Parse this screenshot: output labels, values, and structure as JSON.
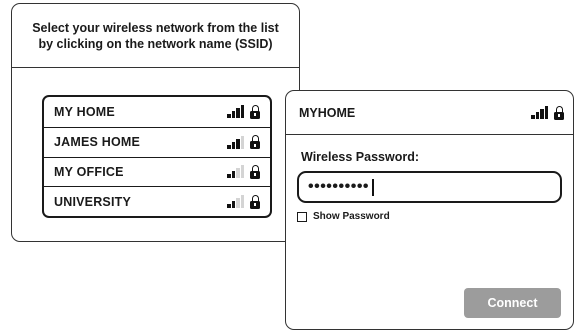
{
  "network_panel": {
    "instruction": "Select your wireless network from the list\nby clicking on the network name (SSID)",
    "networks": [
      {
        "ssid": "MY HOME",
        "signal_bars": 4,
        "locked": true
      },
      {
        "ssid": "JAMES HOME",
        "signal_bars": 3,
        "locked": true
      },
      {
        "ssid": "MY OFFICE",
        "signal_bars": 2,
        "locked": true
      },
      {
        "ssid": "UNIVERSITY",
        "signal_bars": 2,
        "locked": true
      }
    ],
    "icons": {
      "signal": "signal-strength-icon",
      "lock": "lock-icon"
    }
  },
  "password_dialog": {
    "title": "MYHOME",
    "signal_bars": 4,
    "locked": true,
    "password_label": "Wireless Password:",
    "password_value": "••••••••••",
    "show_password_label": "Show Password",
    "show_password_checked": false,
    "connect_label": "Connect"
  },
  "colors": {
    "border": "#333333",
    "text": "#1a1a1a",
    "button_bg": "#9c9c9c",
    "button_text": "#ffffff",
    "signal_on": "#111111",
    "signal_off": "#d4d4d4"
  }
}
